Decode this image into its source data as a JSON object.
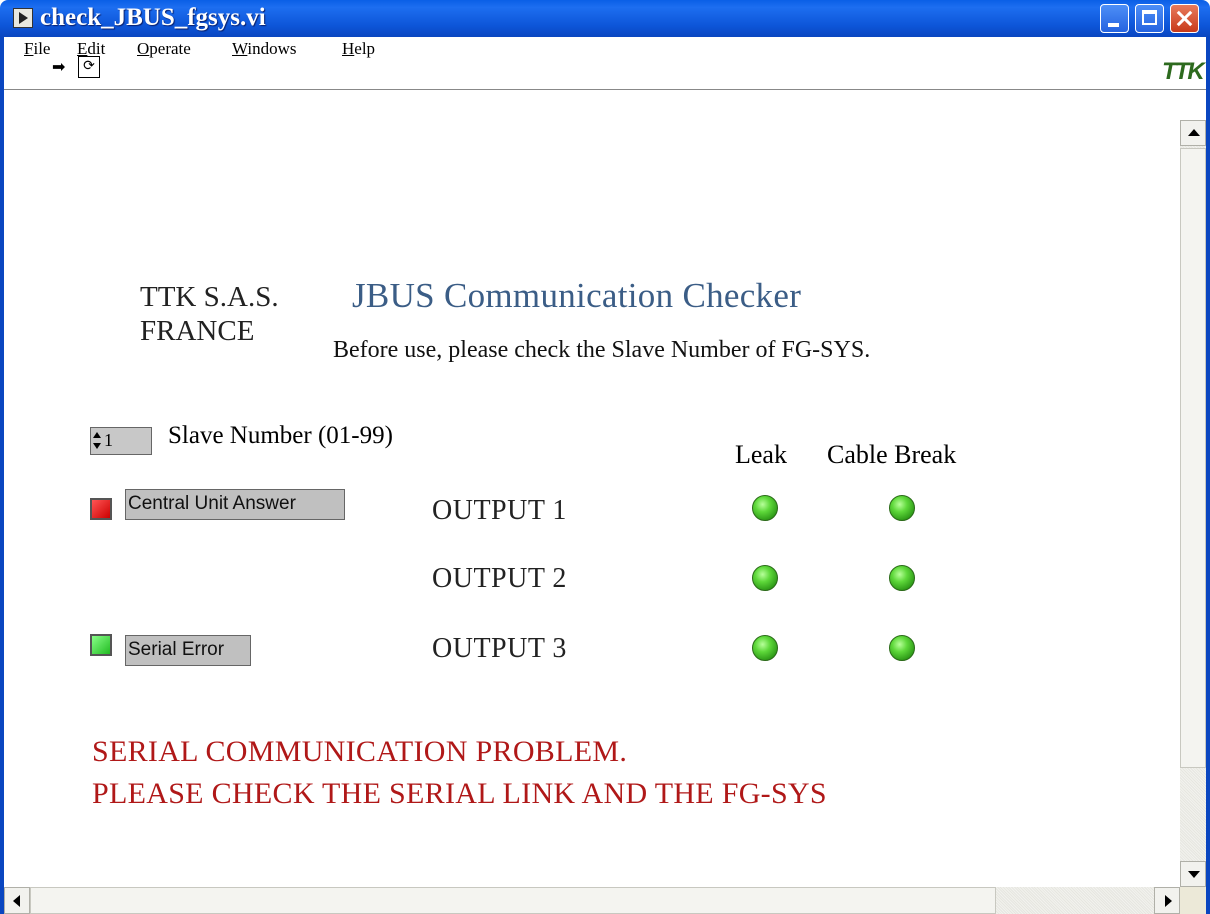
{
  "window": {
    "title": "check_JBUS_fgsys.vi",
    "app_icon": "labview-vi-icon"
  },
  "menu": {
    "items": [
      {
        "label_first": "F",
        "label_rest": "ile"
      },
      {
        "label_first": "E",
        "label_rest": "dit"
      },
      {
        "label_first": "O",
        "label_rest": "perate"
      },
      {
        "label_first": "W",
        "label_rest": "indows"
      },
      {
        "label_first": "H",
        "label_rest": "elp"
      }
    ]
  },
  "toolbar": {
    "run_icon": "run-arrow-icon",
    "run_continuous_icon": "run-continuously-icon",
    "logo_text": "TTK"
  },
  "panel": {
    "company": "TTK S.A.S.",
    "country": "FRANCE",
    "app_title": "JBUS Communication Checker",
    "instruction": "Before use, please check the Slave Number of FG-SYS.",
    "slave_number_value": "1",
    "slave_number_label": "Slave Number (01-99)",
    "columns": {
      "leak": "Leak",
      "cable_break": "Cable Break"
    },
    "central_unit_answer_label": "Central Unit Answer",
    "central_unit_answer_color": "#dd0000",
    "serial_error_label": "Serial Error",
    "serial_error_color": "#33cc33",
    "outputs": [
      {
        "label": "OUTPUT 1",
        "leak": "green",
        "cable_break": "green"
      },
      {
        "label": "OUTPUT 2",
        "leak": "green",
        "cable_break": "green"
      },
      {
        "label": "OUTPUT 3",
        "leak": "green",
        "cable_break": "green"
      }
    ],
    "error_line1": "SERIAL COMMUNICATION PROBLEM.",
    "error_line2": "PLEASE CHECK THE SERIAL LINK AND THE FG-SYS"
  },
  "colors": {
    "title_bar": "#0a5fe6",
    "app_title_text": "#3b5d86",
    "error_text": "#b01818",
    "led_on": "#5ed83a"
  }
}
